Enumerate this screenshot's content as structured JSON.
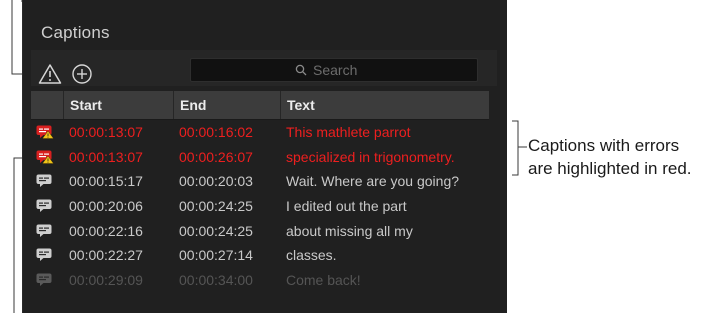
{
  "panel": {
    "title": "Captions"
  },
  "toolbar": {
    "warning_icon": "warning-triangle-icon",
    "add_icon": "plus-circle-icon",
    "search_placeholder": "Search"
  },
  "table": {
    "headers": {
      "start": "Start",
      "end": "End",
      "text": "Text"
    },
    "rows": [
      {
        "start": "00:00:13:07",
        "end": "00:00:16:02",
        "text": "This mathlete parrot",
        "status": "error"
      },
      {
        "start": "00:00:13:07",
        "end": "00:00:26:07",
        "text": "specialized in trigonometry.",
        "status": "error"
      },
      {
        "start": "00:00:15:17",
        "end": "00:00:20:03",
        "text": "Wait. Where are you going?",
        "status": "ok"
      },
      {
        "start": "00:00:20:06",
        "end": "00:00:24:25",
        "text": "I edited out the part",
        "status": "ok"
      },
      {
        "start": "00:00:22:16",
        "end": "00:00:24:25",
        "text": "about missing all my",
        "status": "ok"
      },
      {
        "start": "00:00:22:27",
        "end": "00:00:27:14",
        "text": "classes.",
        "status": "ok"
      },
      {
        "start": "00:00:29:09",
        "end": "00:00:34:00",
        "text": "Come back!",
        "status": "dim"
      }
    ]
  },
  "callout": {
    "line1": "Captions with errors",
    "line2": "are highlighted in red."
  },
  "colors": {
    "error": "#ee1f1f",
    "panel_bg": "#202020",
    "header_bg": "#3c3c3c"
  }
}
